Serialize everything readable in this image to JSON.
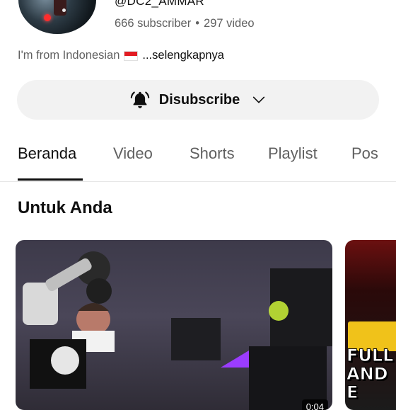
{
  "channel": {
    "handle": "@DC2_AMMAR",
    "subscribers": "666 subscriber",
    "separator": "•",
    "videos": "297 video",
    "description": "I'm from Indonesian",
    "more": "...selengkapnya"
  },
  "subscribe_button": {
    "label": "Disubscribe",
    "icon": "bell-ring-icon",
    "dropdown_icon": "chevron-down-icon"
  },
  "tabs": [
    {
      "label": "Beranda",
      "active": true
    },
    {
      "label": "Video",
      "active": false
    },
    {
      "label": "Shorts",
      "active": false
    },
    {
      "label": "Playlist",
      "active": false
    },
    {
      "label": "Pos",
      "active": false
    }
  ],
  "section": {
    "title": "Untuk Anda"
  },
  "cards": [
    {
      "duration": "0:04"
    },
    {
      "overlay_text_1": "FULL",
      "overlay_text_2": "AND",
      "overlay_text_3": "E"
    }
  ],
  "colors": {
    "text_primary": "#0f0f0f",
    "text_secondary": "#606060",
    "button_bg": "#f2f2f2",
    "flag_red": "#e21b22"
  }
}
